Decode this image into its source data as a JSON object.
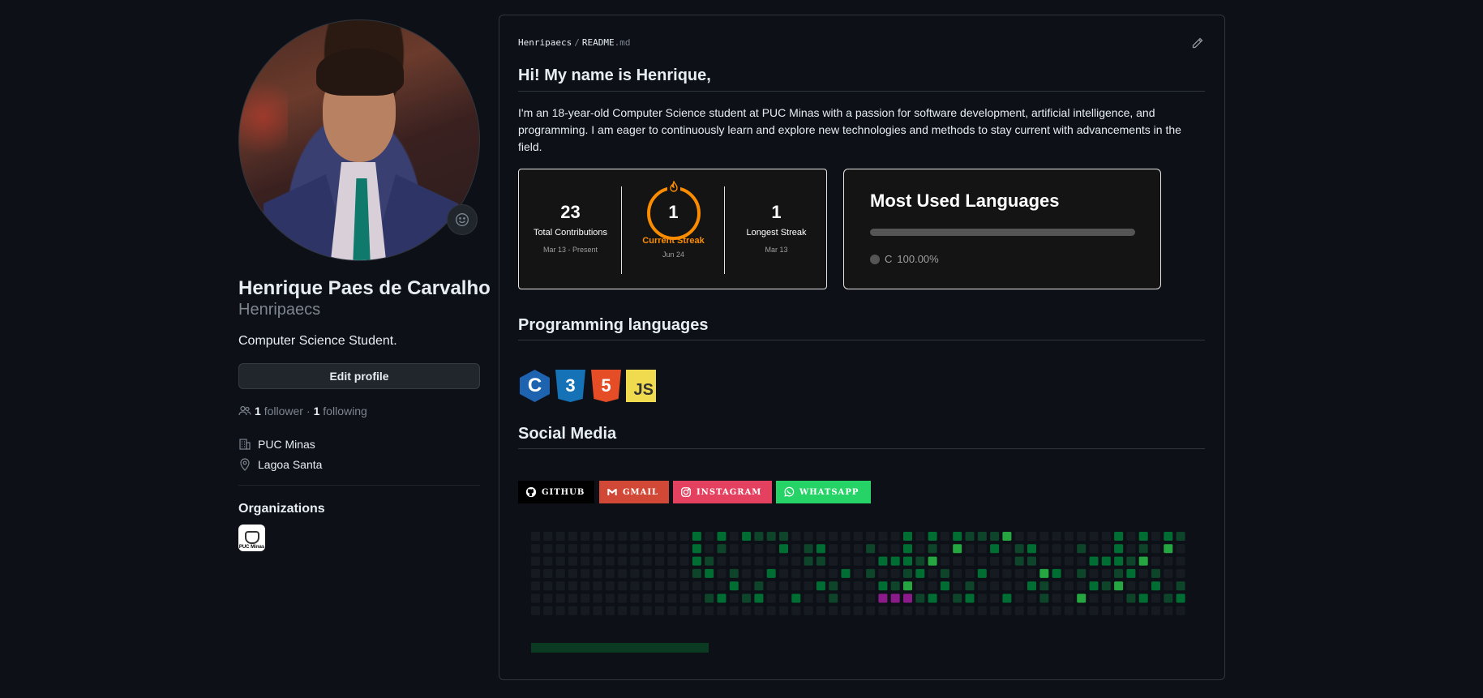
{
  "profile": {
    "full_name": "Henrique Paes de Carvalho",
    "login": "Henripaecs",
    "bio": "Computer Science Student.",
    "edit_button": "Edit profile",
    "followers_count": "1",
    "followers_label": "follower",
    "separator": "·",
    "following_count": "1",
    "following_label": "following",
    "company": "PUC Minas",
    "location": "Lagoa Santa",
    "organizations_title": "Organizations",
    "org_logo_text": "PUC Minas"
  },
  "readme": {
    "breadcrumb_user": "Henripaecs",
    "breadcrumb_sep": "/",
    "breadcrumb_file": "README",
    "breadcrumb_ext": ".md",
    "heading": "Hi! My name is Henrique,",
    "intro": "I'm an 18-year-old Computer Science student at PUC Minas with a passion for software development, artificial intelligence, and programming. I am eager to continuously learn and explore new technologies and methods to stay current with advancements in the field.",
    "streak": {
      "total": "23",
      "total_label": "Total Contributions",
      "total_range": "Mar 13 - Present",
      "current": "1",
      "current_label": "Current Streak",
      "current_date": "Jun 24",
      "longest": "1",
      "longest_label": "Longest Streak",
      "longest_date": "Mar 13",
      "accent_color": "#fb8c00"
    },
    "languages_card": {
      "title": "Most Used Languages",
      "language": "C",
      "percent": "100.00%",
      "percent_value": 100,
      "color": "#555555"
    },
    "programming_title": "Programming languages",
    "lang_icons": [
      {
        "name": "c-icon",
        "glyph": "C"
      },
      {
        "name": "css3-icon",
        "glyph": "3"
      },
      {
        "name": "html5-icon",
        "glyph": "5"
      },
      {
        "name": "javascript-icon",
        "glyph": "JS"
      }
    ],
    "social_title": "Social Media",
    "badges": [
      {
        "label": "GITHUB",
        "color": "#000000",
        "icon": "github-icon"
      },
      {
        "label": "GMAIL",
        "color": "#d14836",
        "icon": "gmail-icon"
      },
      {
        "label": "INSTAGRAM",
        "color": "#e4405f",
        "icon": "instagram-icon"
      },
      {
        "label": "WHATSAPP",
        "color": "#25d366",
        "icon": "whatsapp-icon"
      }
    ]
  },
  "colors": {
    "background": "#0d1117",
    "border": "#30363d",
    "text": "#e6edf3",
    "muted": "#7d8590"
  }
}
